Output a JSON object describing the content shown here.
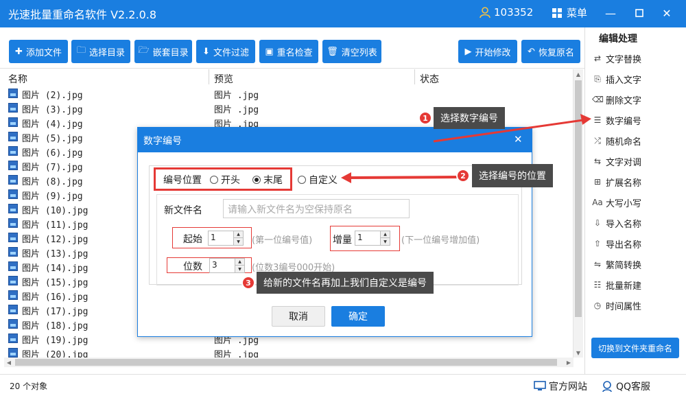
{
  "window": {
    "title": "光速批量重命名软件 V2.2.0.8",
    "user_id": "103352",
    "menu_label": "菜单",
    "accent_color": "#1a7ee0"
  },
  "toolbar": {
    "add_file": "添加文件",
    "select_dir": "选择目录",
    "nested_dir": "嵌套目录",
    "file_filter": "文件过滤",
    "rename_check": "重名检查",
    "clear_list": "清空列表",
    "start_modify": "开始修改",
    "restore_name": "恢复原名"
  },
  "panel": {
    "title": "编辑处理",
    "items": [
      {
        "label": "文字替换",
        "icon": "replace-icon"
      },
      {
        "label": "插入文字",
        "icon": "insert-text-icon"
      },
      {
        "label": "删除文字",
        "icon": "delete-text-icon"
      },
      {
        "label": "数字编号",
        "icon": "numbering-icon"
      },
      {
        "label": "随机命名",
        "icon": "shuffle-icon"
      },
      {
        "label": "文字对调",
        "icon": "swap-icon"
      },
      {
        "label": "扩展名称",
        "icon": "extension-icon"
      },
      {
        "label": "大写小写",
        "icon": "case-icon"
      },
      {
        "label": "导入名称",
        "icon": "import-icon"
      },
      {
        "label": "导出名称",
        "icon": "export-icon"
      },
      {
        "label": "繁简转换",
        "icon": "convert-icon"
      },
      {
        "label": "批量新建",
        "icon": "batch-new-icon"
      },
      {
        "label": "时间属性",
        "icon": "clock-icon"
      }
    ],
    "switch_button": "切换到文件夹重命名"
  },
  "table": {
    "headers": {
      "name": "名称",
      "preview": "预览",
      "status": "状态"
    },
    "rows": [
      {
        "name": "图片 (2).jpg",
        "preview": "图片 .jpg"
      },
      {
        "name": "图片 (3).jpg",
        "preview": "图片 .jpg"
      },
      {
        "name": "图片 (4).jpg",
        "preview": "图片 .jpg"
      },
      {
        "name": "图片 (5).jpg",
        "preview": ""
      },
      {
        "name": "图片 (6).jpg",
        "preview": ""
      },
      {
        "name": "图片 (7).jpg",
        "preview": ""
      },
      {
        "name": "图片 (8).jpg",
        "preview": ""
      },
      {
        "name": "图片 (9).jpg",
        "preview": ""
      },
      {
        "name": "图片 (10).jpg",
        "preview": ""
      },
      {
        "name": "图片 (11).jpg",
        "preview": ""
      },
      {
        "name": "图片 (12).jpg",
        "preview": ""
      },
      {
        "name": "图片 (13).jpg",
        "preview": ""
      },
      {
        "name": "图片 (14).jpg",
        "preview": ""
      },
      {
        "name": "图片 (15).jpg",
        "preview": ""
      },
      {
        "name": "图片 (16).jpg",
        "preview": ""
      },
      {
        "name": "图片 (17).jpg",
        "preview": ""
      },
      {
        "name": "图片 (18).jpg",
        "preview": ""
      },
      {
        "name": "图片 (19).jpg",
        "preview": "图片 .jpg"
      },
      {
        "name": "图片 (20).jpg",
        "preview": "图片 .jpg"
      }
    ]
  },
  "status": {
    "count": "20 个对象",
    "website": "官方网站",
    "qq": "QQ客服"
  },
  "dialog": {
    "title": "数字编号",
    "position_label": "编号位置",
    "opt_start": "开头",
    "opt_end": "末尾",
    "opt_custom": "自定义",
    "selected": "end",
    "new_name_label": "新文件名",
    "new_name_placeholder": "请输入新文件名为空保持原名",
    "start_label": "起始",
    "start_value": "1",
    "start_hint": "(第一位编号值)",
    "increment_label": "增量",
    "increment_value": "1",
    "increment_hint": "(下一位编号增加值)",
    "digits_label": "位数",
    "digits_value": "3",
    "digits_hint": "(位数3编号000开始)",
    "cancel": "取消",
    "confirm": "确定"
  },
  "annotations": [
    {
      "num": "1",
      "text": "选择数字编号"
    },
    {
      "num": "2",
      "text": "选择编号的位置"
    },
    {
      "num": "3",
      "text": "给新的文件名再加上我们自定义是编号"
    }
  ]
}
